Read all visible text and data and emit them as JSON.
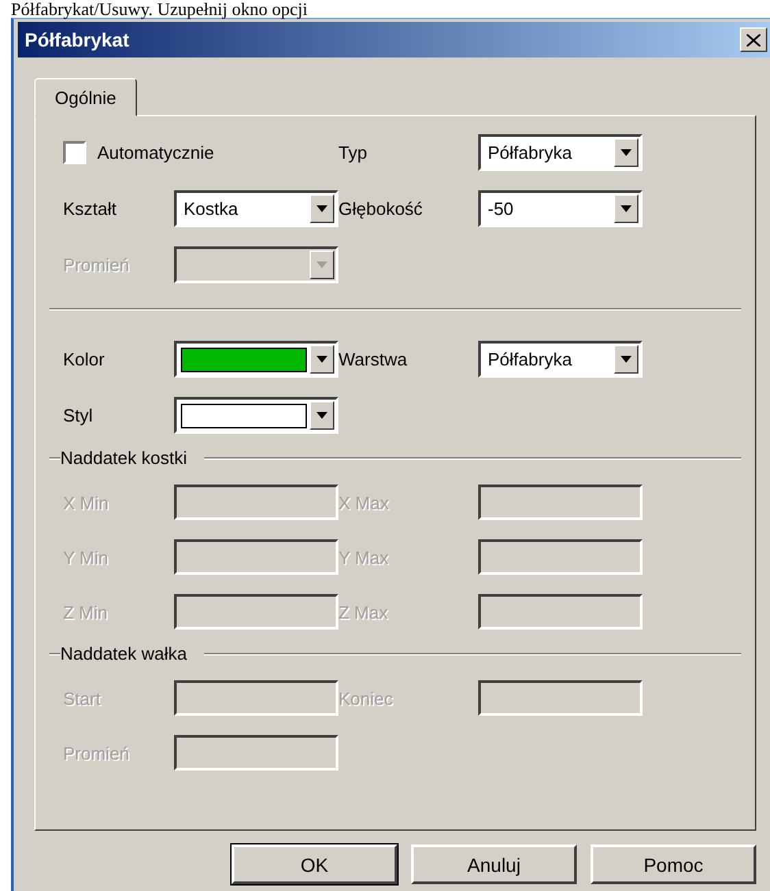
{
  "caption": "Półfabrykat/Usuwy. Uzupełnij okno opcji",
  "window": {
    "title": "Półfabrykat"
  },
  "tabs": [
    {
      "label": "Ogólnie",
      "selected": true
    }
  ],
  "sections": [
    {
      "rows": [
        [
          {
            "kind": "checkbox",
            "label": "Automatycznie",
            "checked": false
          },
          {
            "kind": "combo",
            "label": "Typ",
            "value": "Półfabryka",
            "disabled": false
          }
        ],
        [
          {
            "kind": "combo",
            "label": "Kształt",
            "value": "Kostka",
            "disabled": false
          },
          {
            "kind": "combo",
            "label": "Głębokość",
            "value": "-50",
            "disabled": false
          }
        ],
        [
          {
            "kind": "combo",
            "label": "Promień",
            "disabled": true
          }
        ]
      ]
    },
    {
      "divider": true,
      "rows": [
        [
          {
            "kind": "swatch",
            "label": "Kolor",
            "color": "#00b800"
          },
          {
            "kind": "combo",
            "label": "Warstwa",
            "value": "Półfabryka",
            "disabled": false
          }
        ],
        [
          {
            "kind": "swatch",
            "label": "Styl",
            "color": "#ffffff"
          }
        ]
      ]
    },
    {
      "title": "Naddatek kostki",
      "rows": [
        [
          {
            "kind": "field",
            "label": "X Min",
            "disabled": true
          },
          {
            "kind": "field",
            "label": "X Max",
            "disabled": true
          }
        ],
        [
          {
            "kind": "field",
            "label": "Y Min",
            "disabled": true
          },
          {
            "kind": "field",
            "label": "Y Max",
            "disabled": true
          }
        ],
        [
          {
            "kind": "field",
            "label": "Z Min",
            "disabled": true
          },
          {
            "kind": "field",
            "label": "Z Max",
            "disabled": true
          }
        ]
      ]
    },
    {
      "title": "Naddatek wałka",
      "rows": [
        [
          {
            "kind": "field",
            "label": "Start",
            "disabled": true
          },
          {
            "kind": "field",
            "label": "Koniec",
            "disabled": true
          }
        ],
        [
          {
            "kind": "field",
            "label": "Promień",
            "disabled": true
          }
        ]
      ]
    }
  ],
  "buttons": [
    {
      "label": "OK",
      "default": true
    },
    {
      "label": "Anuluj",
      "default": false
    },
    {
      "label": "Pomoc",
      "default": false
    }
  ]
}
